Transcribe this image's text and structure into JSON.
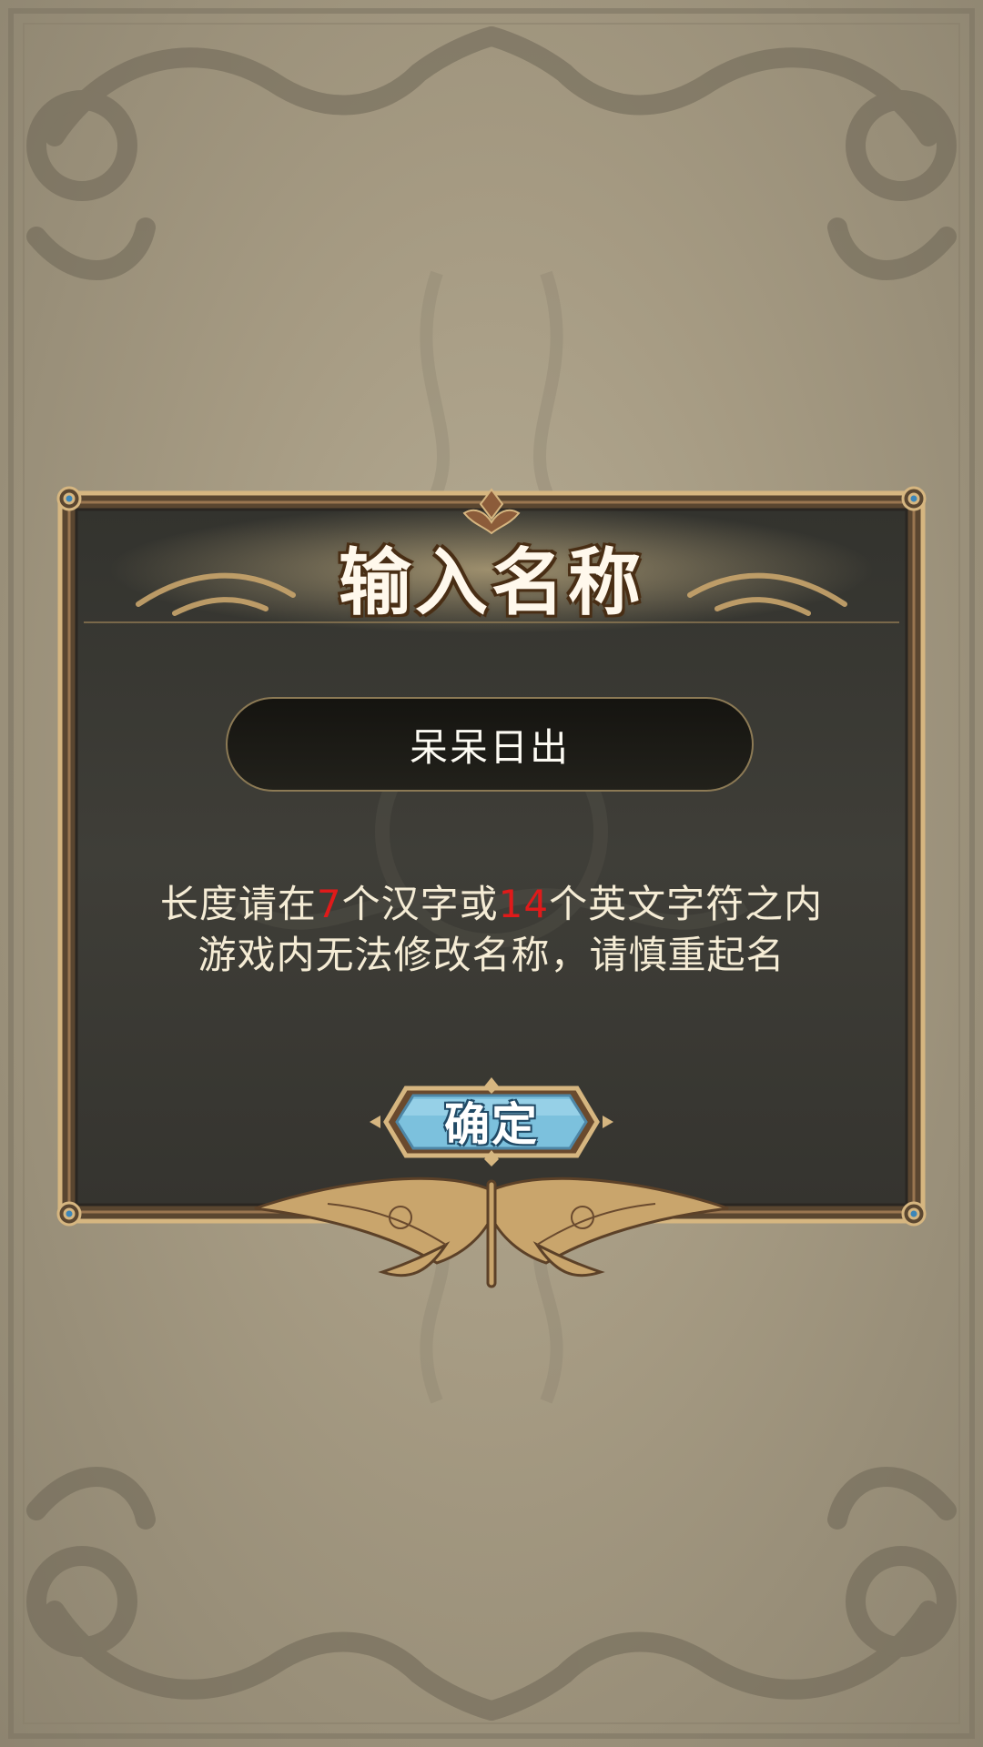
{
  "dialog": {
    "title": "输入名称",
    "name_value": "呆呆日出",
    "hint_line1": {
      "part1": "长度请在",
      "num1": "7",
      "part2": "个汉字或",
      "num2": "14",
      "part3": "个英文字符之内"
    },
    "hint_line2": "游戏内无法修改名称，请慎重起名",
    "confirm_label": "确定"
  },
  "colors": {
    "background": "#a59a82",
    "panel": "#3a3a34",
    "gold_trim": "#d6b680",
    "highlight_number": "#e01a1a",
    "button": "#7cc1dd"
  },
  "icons": [
    "ornate-frame-corner-icon",
    "butterfly-ornament-icon",
    "top-crest-icon"
  ]
}
